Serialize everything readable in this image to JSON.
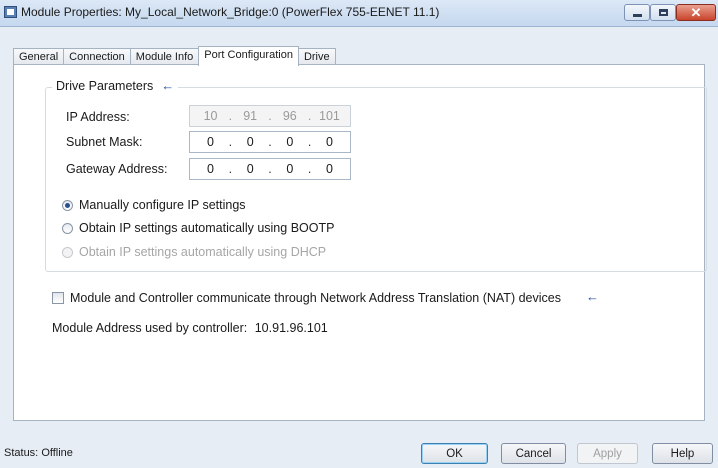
{
  "window": {
    "title": "Module Properties: My_Local_Network_Bridge:0 (PowerFlex 755-EENET 11.1)",
    "close_glyph": "✕"
  },
  "tabs": [
    {
      "label": "General",
      "active": false
    },
    {
      "label": "Connection",
      "active": false
    },
    {
      "label": "Module Info",
      "active": false
    },
    {
      "label": "Port Configuration",
      "active": true
    },
    {
      "label": "Drive",
      "active": false
    }
  ],
  "drive_parameters": {
    "title": "Drive Parameters",
    "arrow": "←",
    "ip_address": {
      "label": "IP Address:",
      "octets": [
        "10",
        "91",
        "96",
        "101"
      ],
      "enabled": false
    },
    "subnet_mask": {
      "label": "Subnet Mask:",
      "octets": [
        "0",
        "0",
        "0",
        "0"
      ],
      "enabled": true
    },
    "gateway_address": {
      "label": "Gateway Address:",
      "octets": [
        "0",
        "0",
        "0",
        "0"
      ],
      "enabled": true
    },
    "options": [
      {
        "label": "Manually configure IP settings",
        "selected": true,
        "enabled": true
      },
      {
        "label": "Obtain IP settings automatically using BOOTP",
        "selected": false,
        "enabled": true
      },
      {
        "label": "Obtain IP settings automatically using DHCP",
        "selected": false,
        "enabled": false
      }
    ]
  },
  "nat": {
    "label": "Module and Controller communicate through Network Address Translation (NAT) devices",
    "checked": false,
    "arrow": "←"
  },
  "module_address": {
    "label": "Module Address used by controller:",
    "value": "10.91.96.101"
  },
  "status": {
    "label": "Status:",
    "value": "Offline"
  },
  "buttons": {
    "ok": "OK",
    "cancel": "Cancel",
    "apply": "Apply",
    "help": "Help"
  },
  "icons": {
    "app": "window-icon",
    "minimize": "minimize-icon",
    "maximize": "maximize-icon",
    "close": "close-icon"
  },
  "colors": {
    "accent": "#2c4fa3",
    "close_button": "#c9432b"
  }
}
